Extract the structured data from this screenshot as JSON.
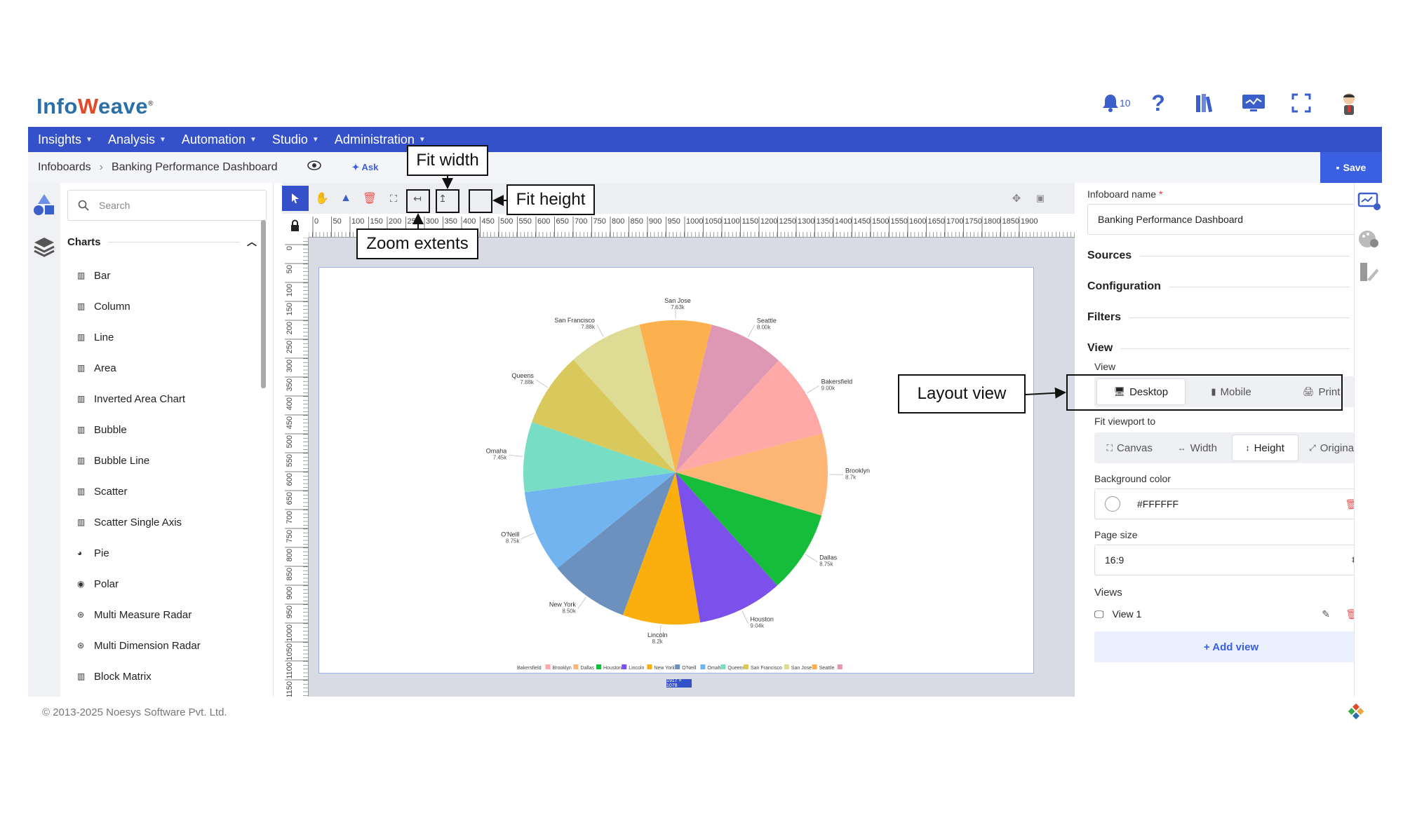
{
  "header": {
    "logo_a": "Info",
    "logo_b": "eave",
    "logo_reg": "®",
    "bell_count": "10"
  },
  "nav": [
    {
      "label": "Insights"
    },
    {
      "label": "Analysis"
    },
    {
      "label": "Automation"
    },
    {
      "label": "Studio"
    },
    {
      "label": "Administration"
    }
  ],
  "breadcrumb": {
    "root": "Infoboards",
    "current": "Banking Performance Dashboard",
    "ask": "Ask"
  },
  "save_label": "Save",
  "left_panel": {
    "search_placeholder": "Search",
    "section": "Charts",
    "items": [
      {
        "label": "Bar",
        "icon": "bar-chart-icon"
      },
      {
        "label": "Column",
        "icon": "column-chart-icon"
      },
      {
        "label": "Line",
        "icon": "line-chart-icon"
      },
      {
        "label": "Area",
        "icon": "area-chart-icon"
      },
      {
        "label": "Inverted Area Chart",
        "icon": "inverted-area-chart-icon"
      },
      {
        "label": "Bubble",
        "icon": "bubble-chart-icon"
      },
      {
        "label": "Bubble Line",
        "icon": "bubble-line-chart-icon"
      },
      {
        "label": "Scatter",
        "icon": "scatter-chart-icon"
      },
      {
        "label": "Scatter Single Axis",
        "icon": "scatter-single-axis-icon"
      },
      {
        "label": "Pie",
        "icon": "pie-chart-icon"
      },
      {
        "label": "Polar",
        "icon": "polar-chart-icon"
      },
      {
        "label": "Multi Measure Radar",
        "icon": "radar-chart-icon"
      },
      {
        "label": "Multi Dimension Radar",
        "icon": "radar-chart-icon"
      },
      {
        "label": "Block Matrix",
        "icon": "block-matrix-icon"
      }
    ]
  },
  "ruler_h": [
    "0",
    "50",
    "100",
    "150",
    "200",
    "250",
    "300",
    "350",
    "400",
    "450",
    "500",
    "550",
    "600",
    "650",
    "700",
    "750",
    "800",
    "850",
    "900",
    "950",
    "1000",
    "1050",
    "1100",
    "1150",
    "1200",
    "1250",
    "1300",
    "1350",
    "1400",
    "1450",
    "1500",
    "1550",
    "1600",
    "1650",
    "1700",
    "1750",
    "1800",
    "1850",
    "1900"
  ],
  "ruler_v": [
    "0",
    "50",
    "100",
    "150",
    "200",
    "250",
    "300",
    "350",
    "400",
    "450",
    "500",
    "550",
    "600",
    "650",
    "700",
    "750",
    "800",
    "850",
    "900",
    "950",
    "1000",
    "1050",
    "1100",
    "1150"
  ],
  "page_size_badge": "1917 × 1078",
  "chart_data": {
    "type": "pie",
    "categories": [
      "San Jose",
      "Seattle",
      "Bakersfield",
      "Brooklyn",
      "Dallas",
      "Houston",
      "Lincoln",
      "New York",
      "O'Neill",
      "Omaha",
      "Queens",
      "San Francisco"
    ],
    "values": [
      7.63,
      8.0,
      9.0,
      8.7,
      8.75,
      9.04,
      8.2,
      8.5,
      8.75,
      7.45,
      7.88,
      7.88
    ],
    "data_labels": [
      "7.63k",
      "8.00k",
      "9.00k",
      "8.7k",
      "8.75k",
      "9.04k",
      "8.2k",
      "8.50k",
      "8.75k",
      "7.45k",
      "7.88k",
      "7.88k"
    ],
    "colors": [
      "#fdb14e",
      "#de98b4",
      "#fea8a8",
      "#feb677",
      "#16bd3a",
      "#7b50eb",
      "#fbaf0e",
      "#6c91bf",
      "#72b4f0",
      "#77dec5",
      "#d9c85b",
      "#dedb94"
    ],
    "legend_order": [
      "Bakersfield",
      "Brooklyn",
      "Dallas",
      "Houston",
      "Lincoln",
      "New York",
      "O'Neill",
      "Omaha",
      "Queens",
      "San Francisco",
      "San Jose",
      "Seattle"
    ],
    "legend_position": "bottom"
  },
  "right_panel": {
    "name_label": "Infoboard name",
    "name_required": "*",
    "name_value": "Banking Performance Dashboard",
    "sources": "Sources",
    "configuration": "Configuration",
    "filters": "Filters",
    "view_section": "View",
    "view_label": "View",
    "view_options": [
      "Desktop",
      "Mobile",
      "Print"
    ],
    "fit_label": "Fit viewport to",
    "fit_options": [
      "Canvas",
      "Width",
      "Height",
      "Original"
    ],
    "bg_label": "Background color",
    "bg_value": "#FFFFFF",
    "page_size_label": "Page size",
    "page_size_value": "16:9",
    "views_label": "Views",
    "view_item": "View 1",
    "add_view": "+ Add view"
  },
  "footer": "© 2013-2025 Noesys Software Pvt. Ltd.",
  "callouts": {
    "fit_width": "Fit width",
    "fit_height": "Fit height",
    "zoom_extents": "Zoom extents",
    "layout_view": "Layout view"
  }
}
